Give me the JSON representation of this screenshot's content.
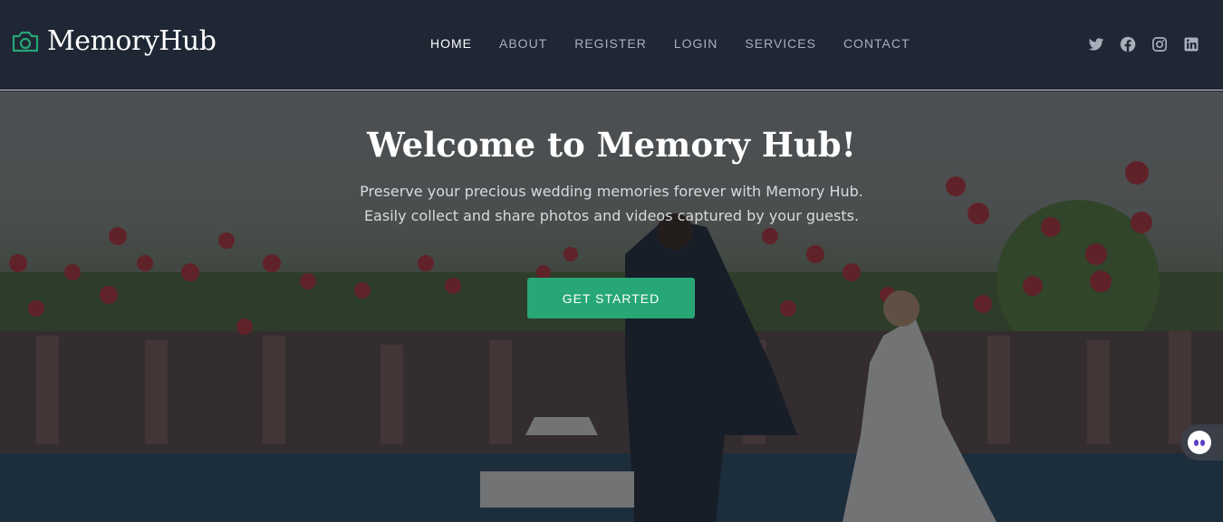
{
  "brand": {
    "name": "MemoryHub",
    "icon": "camera-icon",
    "accent": "#27a776"
  },
  "nav": {
    "items": [
      {
        "label": "HOME",
        "active": true
      },
      {
        "label": "ABOUT",
        "active": false
      },
      {
        "label": "REGISTER",
        "active": false
      },
      {
        "label": "LOGIN",
        "active": false
      },
      {
        "label": "SERVICES",
        "active": false
      },
      {
        "label": "CONTACT",
        "active": false
      }
    ]
  },
  "social": [
    "twitter-icon",
    "facebook-icon",
    "instagram-icon",
    "linkedin-icon"
  ],
  "hero": {
    "title": "Welcome to Memory Hub!",
    "subtitle": "Preserve your precious wedding memories forever with Memory Hub. Easily collect and share photos and videos captured by your guests.",
    "cta_label": "GET STARTED",
    "background": "wedding-balloons-photo"
  },
  "chat_widget": {
    "icon": "chat-bot-icon"
  },
  "colors": {
    "header_bg": "#1f2634",
    "cta_bg": "#27a776"
  }
}
